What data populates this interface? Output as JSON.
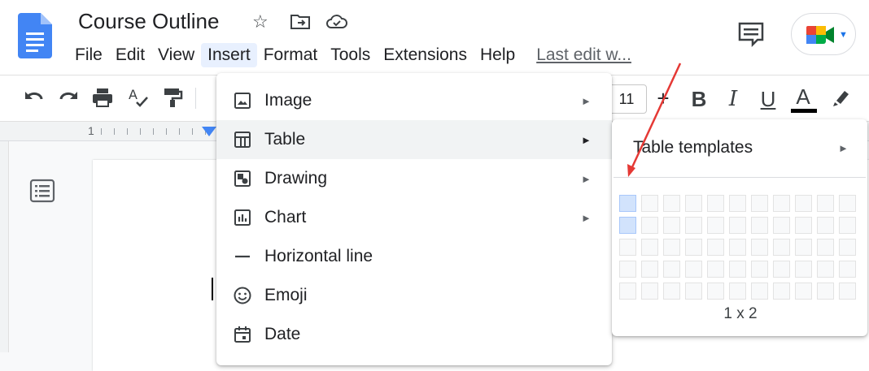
{
  "header": {
    "doc_title": "Course Outline",
    "last_edit": "Last edit w..."
  },
  "menubar": {
    "items": [
      "File",
      "Edit",
      "View",
      "Insert",
      "Format",
      "Tools",
      "Extensions",
      "Help"
    ],
    "active": "Insert"
  },
  "toolbar": {
    "font_size": "11",
    "plus": "+",
    "bold": "B",
    "italic": "I",
    "underline": "U",
    "text_color": "A",
    "text_color_bar": "#000000"
  },
  "ruler": {
    "mark": "1"
  },
  "insert_menu": {
    "items": [
      {
        "label": "Image",
        "icon": "image-icon",
        "submenu": true
      },
      {
        "label": "Table",
        "icon": "table-icon",
        "submenu": true,
        "highlighted": true
      },
      {
        "label": "Drawing",
        "icon": "drawing-icon",
        "submenu": true
      },
      {
        "label": "Chart",
        "icon": "chart-icon",
        "submenu": true
      },
      {
        "label": "Horizontal line",
        "icon": "horizontal-line-icon",
        "submenu": false
      },
      {
        "label": "Emoji",
        "icon": "emoji-icon",
        "submenu": false
      },
      {
        "label": "Date",
        "icon": "calendar-icon",
        "submenu": false
      }
    ]
  },
  "table_submenu": {
    "templates_label": "Table templates",
    "grid_columns": 11,
    "grid_rows": 5,
    "selected_columns": 1,
    "selected_rows": 2,
    "size_label": "1 x 2"
  },
  "colors": {
    "accent_blue": "#4285f4",
    "selection_blue": "#d2e3fc",
    "annotation_red": "#e53935"
  }
}
